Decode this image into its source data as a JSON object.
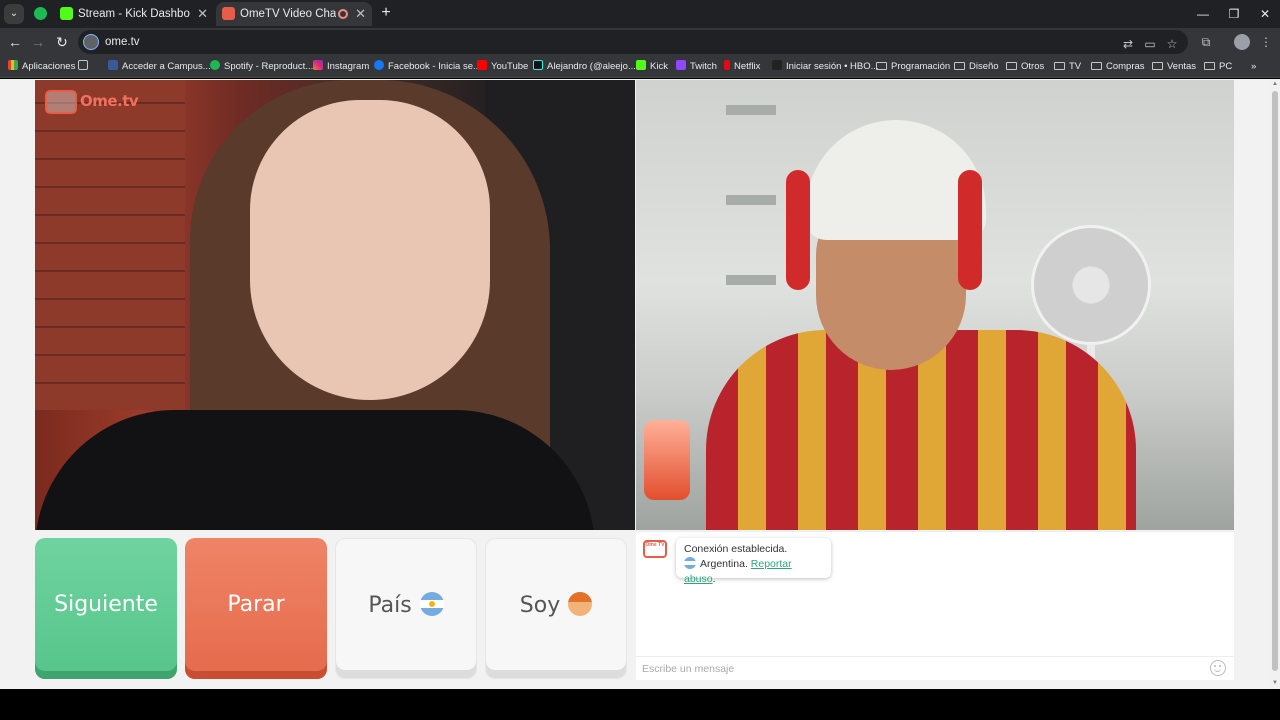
{
  "browser": {
    "tabs": [
      {
        "title": "",
        "icon": "spotify-icon",
        "pinned": true
      },
      {
        "title": "Stream - Kick Dashboard",
        "icon": "kick-icon"
      },
      {
        "title": "OmeTV Video Chat — Ome",
        "icon": "ometv-icon",
        "active": true,
        "recording": true
      }
    ],
    "url": "ome.tv",
    "bookmarks": [
      {
        "label": "Aplicaciones",
        "icon": "apps-grid-icon"
      },
      {
        "label": "Acceder a Campus...",
        "icon": "campus-icon"
      },
      {
        "label": "Spotify - Reproduct...",
        "icon": "spotify-icon"
      },
      {
        "label": "Instagram",
        "icon": "instagram-icon"
      },
      {
        "label": "Facebook - Inicia se...",
        "icon": "facebook-icon"
      },
      {
        "label": "YouTube",
        "icon": "youtube-icon"
      },
      {
        "label": "Alejandro (@aleejo....",
        "icon": "tiktok-icon"
      },
      {
        "label": "Kick",
        "icon": "kick-icon"
      },
      {
        "label": "Twitch",
        "icon": "twitch-icon"
      },
      {
        "label": "Netflix",
        "icon": "netflix-icon"
      },
      {
        "label": "Iniciar sesión • HBO...",
        "icon": "hbo-icon"
      },
      {
        "label": "Programación",
        "icon": "folder-icon"
      },
      {
        "label": "Diseño",
        "icon": "folder-icon"
      },
      {
        "label": "Otros",
        "icon": "folder-icon"
      },
      {
        "label": "TV",
        "icon": "folder-icon"
      },
      {
        "label": "Compras",
        "icon": "folder-icon"
      },
      {
        "label": "Ventas",
        "icon": "folder-icon"
      },
      {
        "label": "PC",
        "icon": "folder-icon"
      }
    ]
  },
  "app": {
    "logo_text": "Ome.tv",
    "logo_badge": "Ome TV",
    "buttons": {
      "next": "Siguiente",
      "stop": "Parar",
      "country": "País",
      "gender": "Soy"
    },
    "chat": {
      "status": "Conexión establecida.",
      "country": "Argentina.",
      "report": "Reportar abuso",
      "report_suffix": ".",
      "input_placeholder": "Escribe un mensaje"
    }
  },
  "colors": {
    "next": "#56c58a",
    "stop": "#e56a4c",
    "brand": "#e85d4a",
    "link": "#2fa57f"
  }
}
